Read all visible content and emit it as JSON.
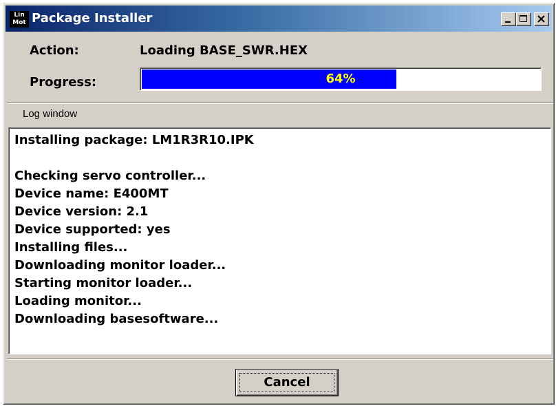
{
  "window": {
    "title": "Package Installer",
    "logo": {
      "top": "Lin",
      "bottom": "Mot"
    }
  },
  "controls": {
    "minimize": "minimize-icon",
    "maximize": "maximize-icon",
    "close": "close-icon"
  },
  "action": {
    "label": "Action:",
    "value": "Loading BASE_SWR.HEX"
  },
  "progress": {
    "label": "Progress:",
    "value": 64,
    "text": "64%",
    "fill_color": "#0000ff",
    "text_color": "#ffff00"
  },
  "log": {
    "caption": "Log window",
    "lines": [
      "Installing package: LM1R3R10.IPK",
      "",
      "Checking servo controller...",
      "Device name: E400MT",
      "Device version: 2.1",
      "Device supported: yes",
      "Installing files...",
      "Downloading monitor loader...",
      "Starting monitor loader...",
      "Loading monitor...",
      "Downloading basesoftware..."
    ]
  },
  "buttons": {
    "cancel_label": "Cancel"
  }
}
